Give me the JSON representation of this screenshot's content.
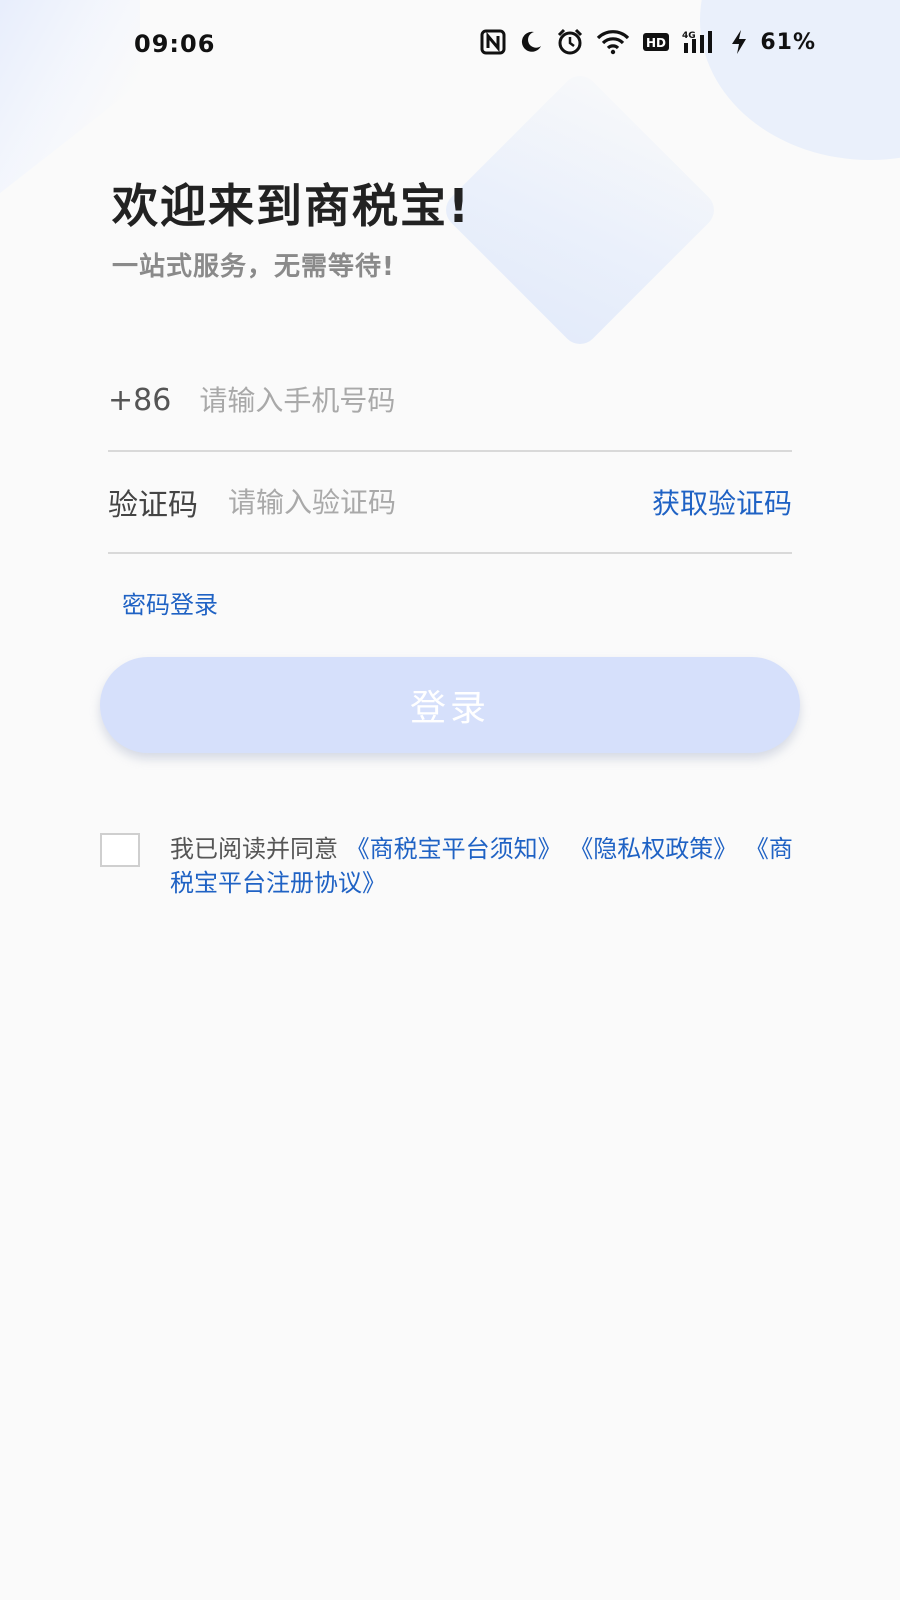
{
  "status_bar": {
    "time": "09:06",
    "battery": "61%",
    "icons": [
      "nfc-icon",
      "moon-icon",
      "alarm-icon",
      "wifi-icon",
      "hd-icon",
      "signal-4g-icon",
      "charging-icon"
    ]
  },
  "header": {
    "title": "欢迎来到商税宝!",
    "subtitle": "一站式服务，无需等待!"
  },
  "form": {
    "country_code": "+86",
    "phone_placeholder": "请输入手机号码",
    "phone_value": "",
    "code_label": "验证码",
    "code_placeholder": "请输入验证码",
    "code_value": "",
    "get_code_label": "获取验证码",
    "password_login_label": "密码登录",
    "login_label": "登录"
  },
  "agreement": {
    "checked": false,
    "prefix": "我已阅读并同意",
    "link1": "《商税宝平台须知》",
    "link2": "《隐私权政策》",
    "link3": "《商税宝平台注册协议》"
  },
  "colors": {
    "accent": "#1f62c4",
    "login_button_bg": "#d6e0fb",
    "background": "#fafafa"
  }
}
